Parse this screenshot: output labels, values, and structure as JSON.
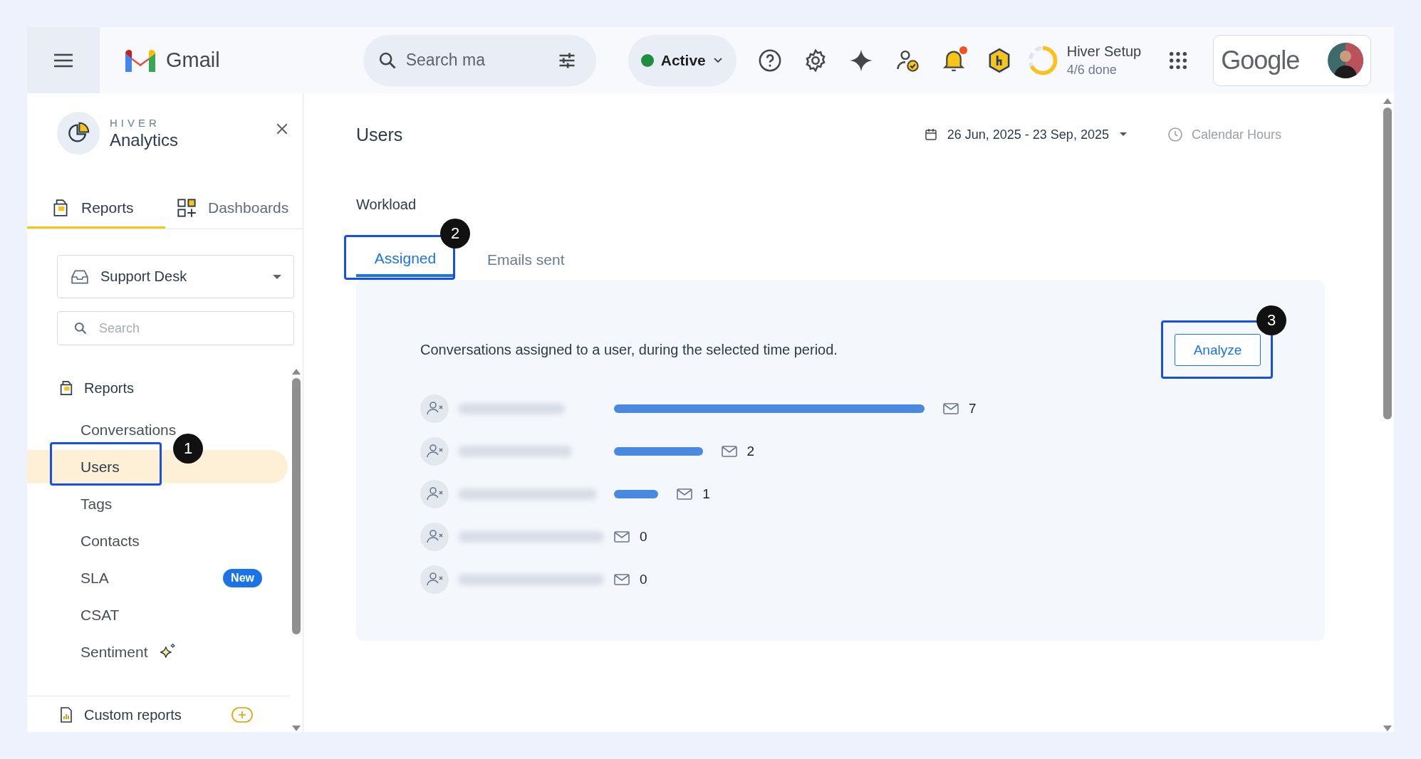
{
  "topbar": {
    "brand": "Gmail",
    "search": {
      "placeholder": "Search ma"
    },
    "status": {
      "label": "Active",
      "color": "#1e8e3e"
    },
    "notification_dot": true,
    "setup": {
      "title": "Hiver Setup",
      "progress": "4/6 done",
      "level": 0.67
    },
    "account_logo": "Google"
  },
  "sidebar": {
    "brand_small": "HIVER",
    "brand": "Analytics",
    "tabs": [
      {
        "label": "Reports",
        "selected": true
      },
      {
        "label": "Dashboards",
        "selected": false
      }
    ],
    "inbox": "Support Desk",
    "search": {
      "placeholder": "Search"
    },
    "section": "Reports",
    "items": [
      {
        "label": "Conversations",
        "kind": "link",
        "selected": false
      },
      {
        "label": "Users",
        "kind": "link",
        "selected": true,
        "callout": "1"
      },
      {
        "label": "Tags",
        "kind": "link",
        "selected": false
      },
      {
        "label": "Contacts",
        "kind": "link",
        "selected": false
      },
      {
        "label": "SLA",
        "kind": "link",
        "selected": false,
        "badge": "New"
      },
      {
        "label": "CSAT",
        "kind": "link",
        "selected": false
      },
      {
        "label": "Sentiment",
        "kind": "ai",
        "selected": false
      }
    ],
    "custom_reports": "Custom reports"
  },
  "main": {
    "title": "Users",
    "date_range": "26 Jun, 2025 - 23 Sep, 2025",
    "hours": "Calendar Hours",
    "section": "Workload",
    "tabs": [
      {
        "label": "Assigned",
        "selected": true,
        "callout": "2"
      },
      {
        "label": "Emails sent",
        "selected": false
      }
    ],
    "description": "Conversations assigned to a user, during the selected time period.",
    "analyze": {
      "label": "Analyze",
      "callout": "3"
    },
    "users": [
      {
        "count": "7"
      },
      {
        "count": "2"
      },
      {
        "count": "1"
      },
      {
        "count": "0"
      },
      {
        "count": "0"
      }
    ]
  }
}
